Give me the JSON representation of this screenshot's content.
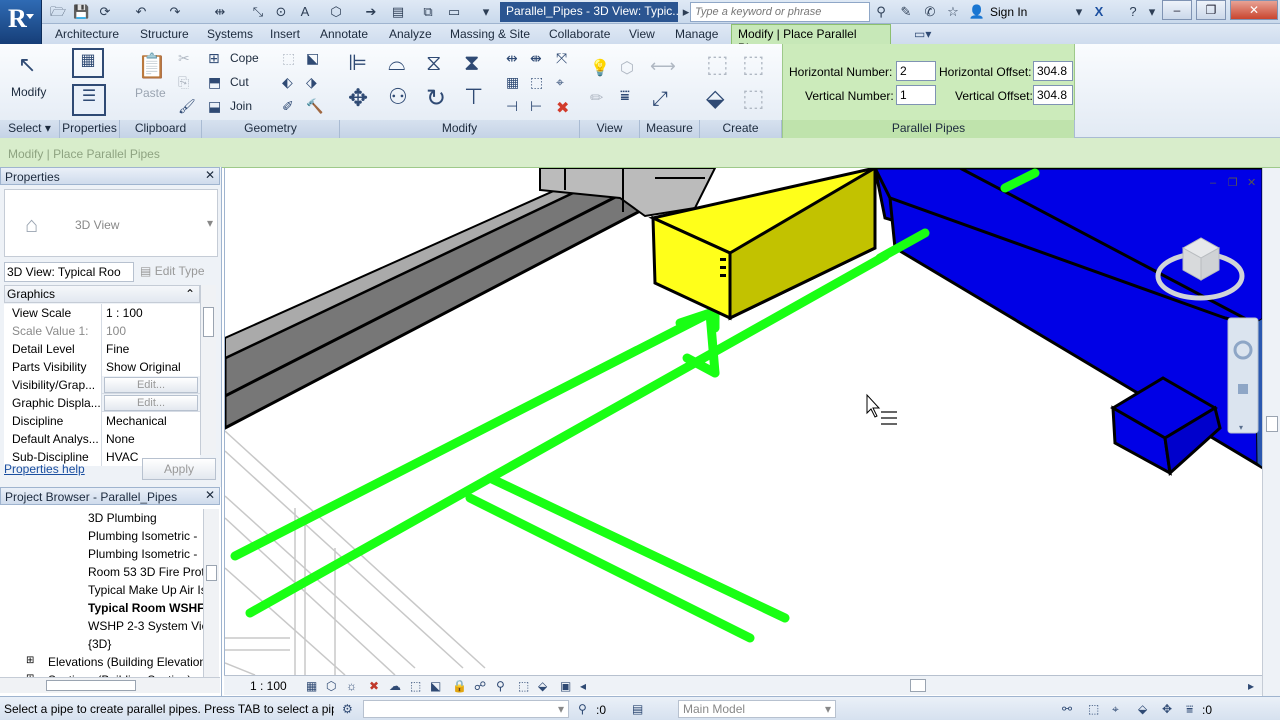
{
  "title_bar": {
    "window_title": "Parallel_Pipes - 3D View: Typic...",
    "search_placeholder": "Type a keyword or phrase",
    "sign_in": "Sign In",
    "app_logo": "R"
  },
  "tabs": [
    "Architecture",
    "Structure",
    "Systems",
    "Insert",
    "Annotate",
    "Analyze",
    "Massing & Site",
    "Collaborate",
    "View",
    "Manage"
  ],
  "active_tab": "Modify | Place Parallel Pipes",
  "ribbon": {
    "modify_label": "Modify",
    "paste_label": "Paste",
    "cope_label": "Cope",
    "cut_label": "Cut",
    "join_label": "Join",
    "panels": [
      "Select",
      "Properties",
      "Clipboard",
      "Geometry",
      "Modify",
      "View",
      "Measure",
      "Create",
      "Parallel Pipes"
    ]
  },
  "parallel_pipes": {
    "horizontal_number_label": "Horizontal Number:",
    "horizontal_number": "2",
    "horizontal_offset_label": "Horizontal Offset:",
    "horizontal_offset": "304.8",
    "vertical_number_label": "Vertical Number:",
    "vertical_number": "1",
    "vertical_offset_label": "Vertical Offset:",
    "vertical_offset": "304.8"
  },
  "options_bar": "Modify | Place Parallel Pipes",
  "properties": {
    "title": "Properties",
    "type_name": "3D View",
    "view_selector": "3D View: Typical Roo",
    "edit_type": "Edit Type",
    "section": "Graphics",
    "rows": [
      {
        "k": "View Scale",
        "v": "1 : 100"
      },
      {
        "k": "Scale Value   1:",
        "v": "100"
      },
      {
        "k": "Detail Level",
        "v": "Fine"
      },
      {
        "k": "Parts Visibility",
        "v": "Show Original"
      },
      {
        "k": "Visibility/Grap...",
        "v": "Edit..."
      },
      {
        "k": "Graphic Displa...",
        "v": "Edit..."
      },
      {
        "k": "Discipline",
        "v": "Mechanical"
      },
      {
        "k": "Default Analys...",
        "v": "None"
      },
      {
        "k": "Sub-Discipline",
        "v": "HVAC"
      }
    ],
    "help_link": "Properties help",
    "apply": "Apply"
  },
  "project_browser": {
    "title": "Project Browser - Parallel_Pipes",
    "items": [
      "3D Plumbing",
      "Plumbing Isometric -",
      "Plumbing Isometric -",
      "Room 53 3D Fire Prot",
      "Typical Make Up Air Is",
      "Typical Room WSHF",
      "WSHP 2-3 System Vie",
      "{3D}",
      "Elevations (Building Elevation",
      "Sections (Building Section)"
    ]
  },
  "view_bar": {
    "scale": "1 : 100"
  },
  "status_bar": {
    "message": "Select a pipe to create parallel pipes. Press TAB to select a pipe run.",
    "selection_count": ":0",
    "workset": "Main Model",
    "filter_count": ":0"
  },
  "colors": {
    "ribbon_context": "#ccebbb",
    "pipe": "#19ff14",
    "duct_blue": "#0000e6",
    "duct_yellow": "#ffff1a"
  }
}
